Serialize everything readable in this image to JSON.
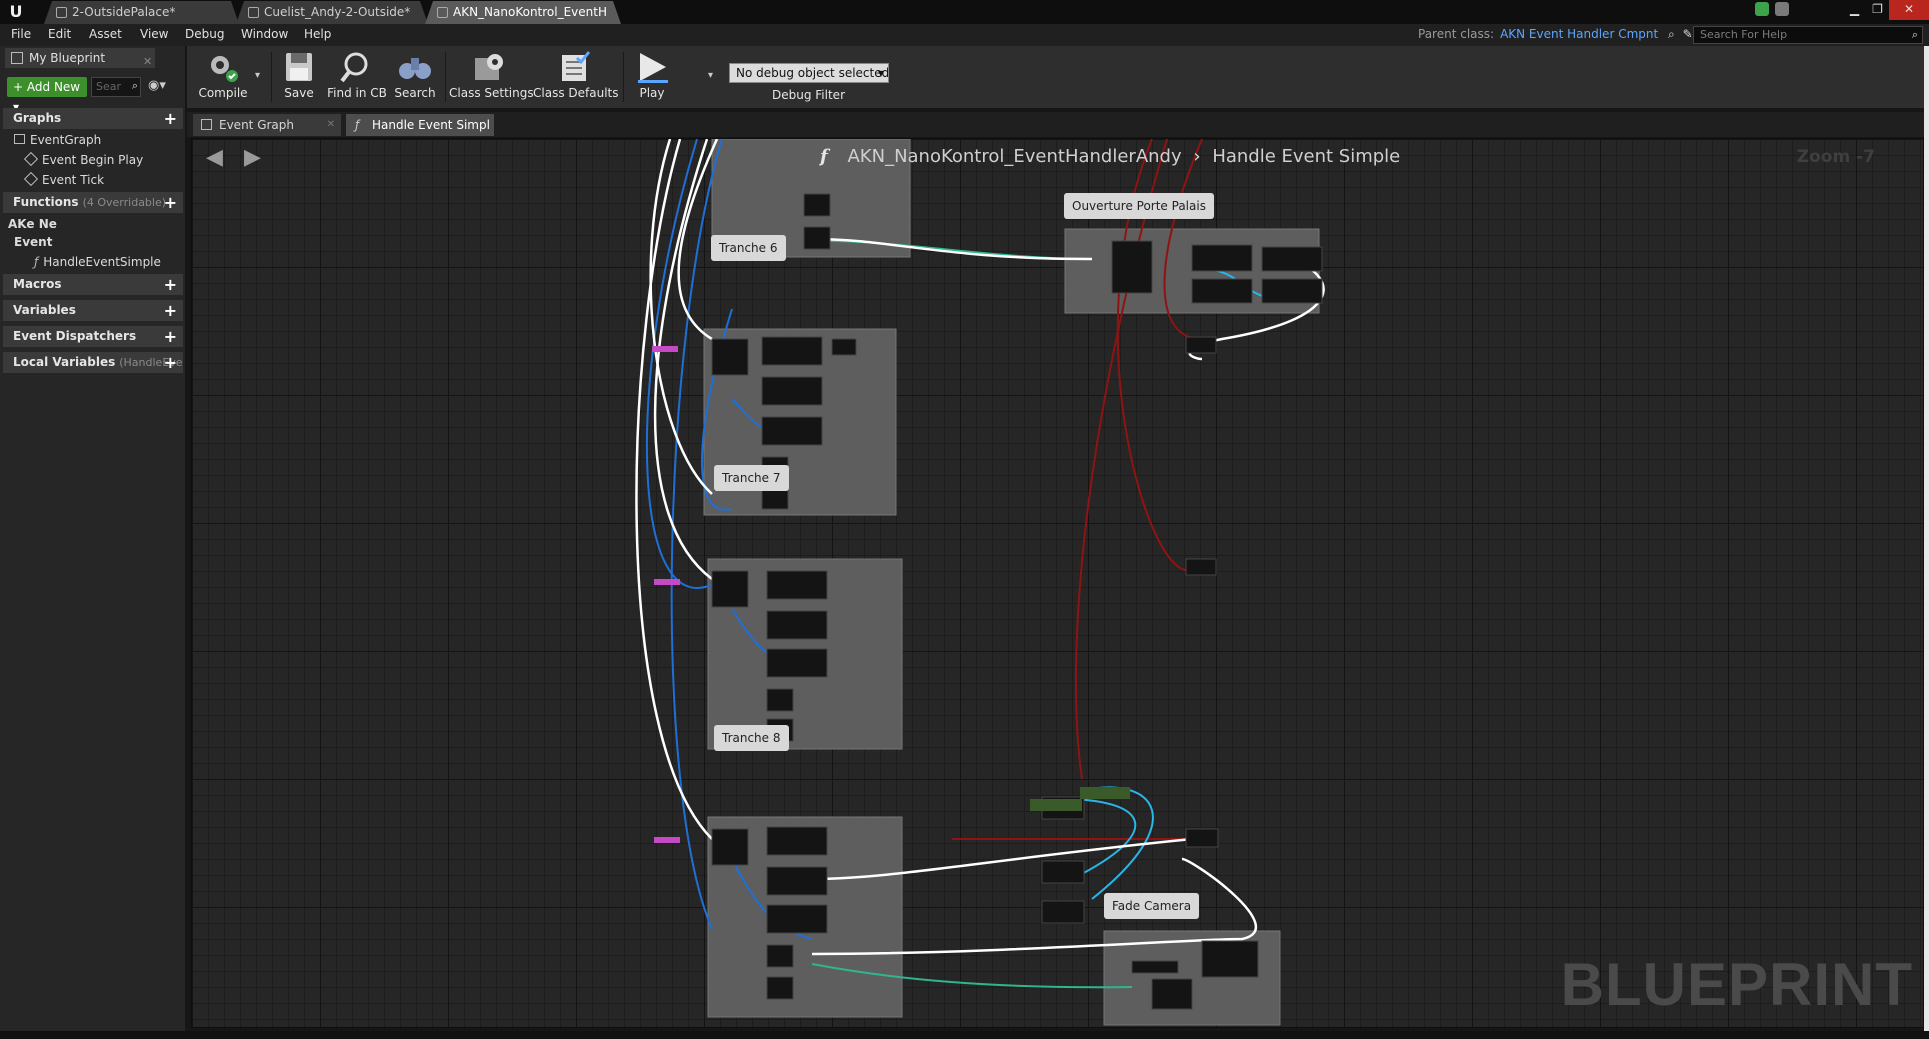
{
  "window": {
    "tabs": [
      {
        "label": "2-OutsidePalace*"
      },
      {
        "label": "Cuelist_Andy-2-Outside*"
      },
      {
        "label": "AKN_NanoKontrol_EventH"
      }
    ]
  },
  "menu": [
    "File",
    "Edit",
    "Asset",
    "View",
    "Debug",
    "Window",
    "Help"
  ],
  "parent_class": {
    "label": "Parent class:",
    "value": "AKN Event Handler Cmpnt"
  },
  "help_search": {
    "placeholder": "Search For Help"
  },
  "my_blueprint": {
    "tab_label": "My Blueprint",
    "add_new_label": "Add New",
    "search_placeholder": "Sear",
    "sections": {
      "graphs": "Graphs",
      "event_graph": "EventGraph",
      "event_begin_play": "Event Begin Play",
      "event_tick": "Event Tick",
      "functions": "Functions",
      "functions_sub": "(4 Overridable)",
      "ake_ne": "AKe Ne",
      "event": "Event",
      "handle_event_simple": "HandleEventSimple",
      "macros": "Macros",
      "variables": "Variables",
      "event_dispatchers": "Event Dispatchers",
      "local_variables": "Local Variables",
      "local_variables_sub": "(HandleEve"
    }
  },
  "toolbar": {
    "compile": "Compile",
    "save": "Save",
    "find_in_cb": "Find in CB",
    "search": "Search",
    "class_settings": "Class Settings",
    "class_defaults": "Class Defaults",
    "play": "Play",
    "debug_select": "No debug object selected",
    "debug_filter": "Debug Filter"
  },
  "graph_tabs": [
    {
      "label": "Event Graph"
    },
    {
      "label": "Handle Event Simpl"
    }
  ],
  "graph": {
    "breadcrumb_root": "AKN_NanoKontrol_EventHandlerAndy",
    "breadcrumb_leaf": "Handle Event Simple",
    "zoom": "Zoom -7",
    "watermark": "BLUEPRINT",
    "comments": {
      "ouverture": "Ouverture Porte Palais",
      "tranche6": "Tranche 6",
      "tranche7": "Tranche 7",
      "tranche8": "Tranche 8",
      "fade_camera": "Fade Camera"
    }
  },
  "colors": {
    "exec_wire": "#ffffff",
    "blue_wire": "#1f6fd6",
    "cyan_wire": "#29b6e8",
    "red_wire": "#8e1414",
    "teal_wire": "#2fb58f",
    "add_new": "#3d8f2b",
    "parent_class_link": "#5aa6ff"
  }
}
